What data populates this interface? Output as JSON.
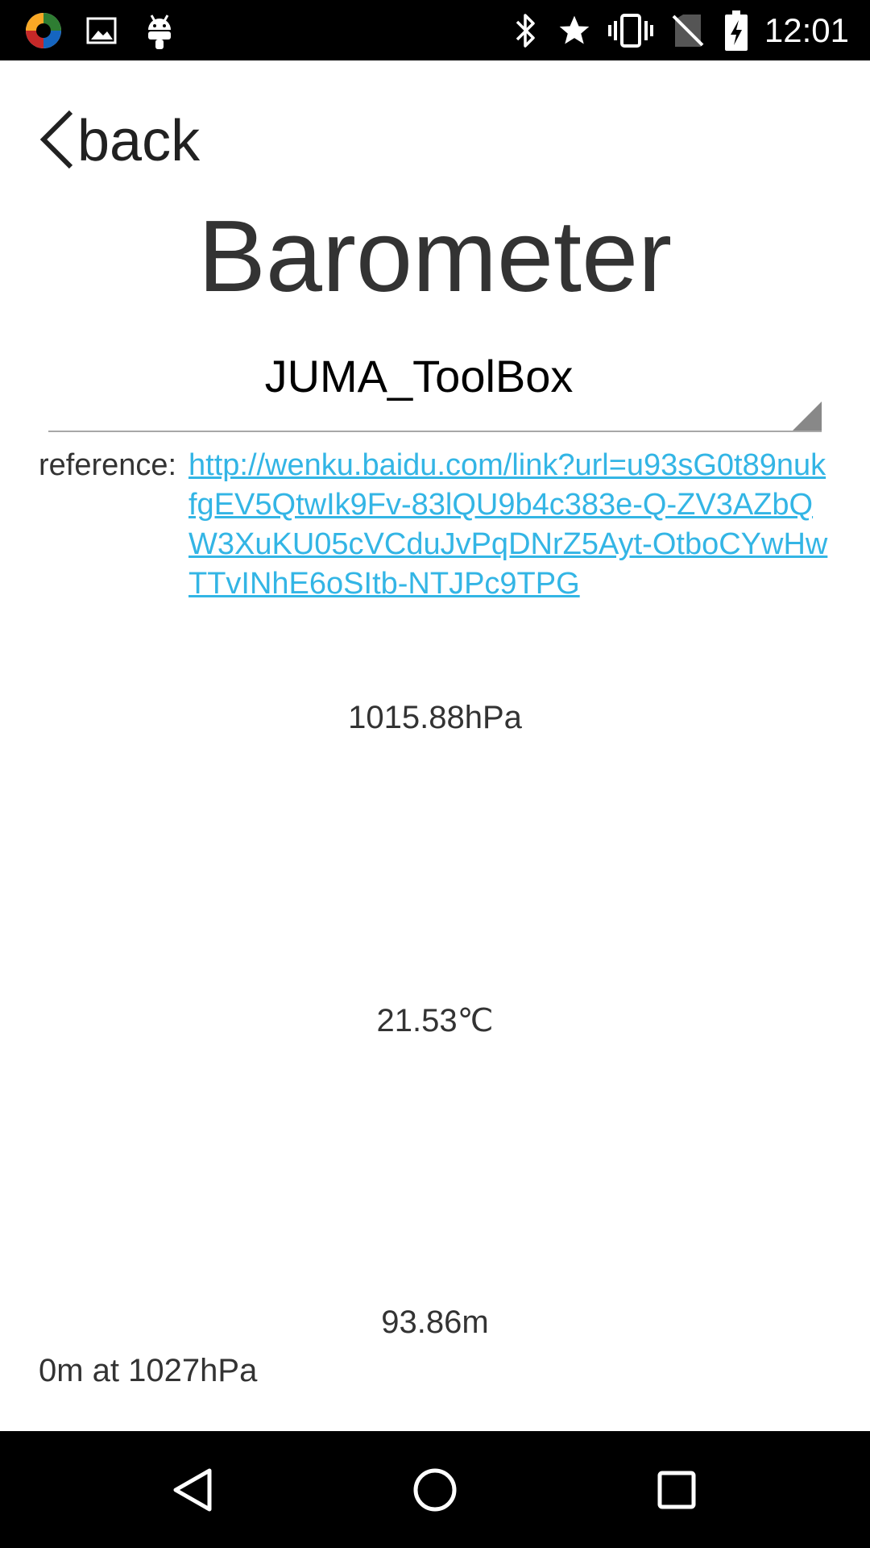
{
  "status_bar": {
    "time": "12:01",
    "left_icons": [
      "app-logo-icon",
      "image-icon",
      "android-icon"
    ],
    "right_icons": [
      "bluetooth-icon",
      "star-icon",
      "vibrate-icon",
      "no-sim-icon",
      "battery-charging-icon"
    ]
  },
  "header": {
    "back_label": "back",
    "title": "Barometer"
  },
  "spinner": {
    "selected": "JUMA_ToolBox"
  },
  "reference": {
    "label": "reference:",
    "url": "http://wenku.baidu.com/link?url=u93sG0t89nukfgEV5QtwIk9Fv-83lQU9b4c383e-Q-ZV3AZbQW3XuKU05cVCduJvPqDNrZ5Ayt-OtboCYwHwTTvINhE6oSItb-NTJPc9TPG"
  },
  "readings": {
    "pressure": "1015.88hPa",
    "temperature": "21.53℃",
    "altitude": "93.86m",
    "baseline": "0m at 1027hPa"
  },
  "colors": {
    "link": "#33b5e5",
    "text": "#333333"
  },
  "nav_bar": {
    "icons": [
      "back-triangle-icon",
      "home-circle-icon",
      "recents-square-icon"
    ]
  }
}
